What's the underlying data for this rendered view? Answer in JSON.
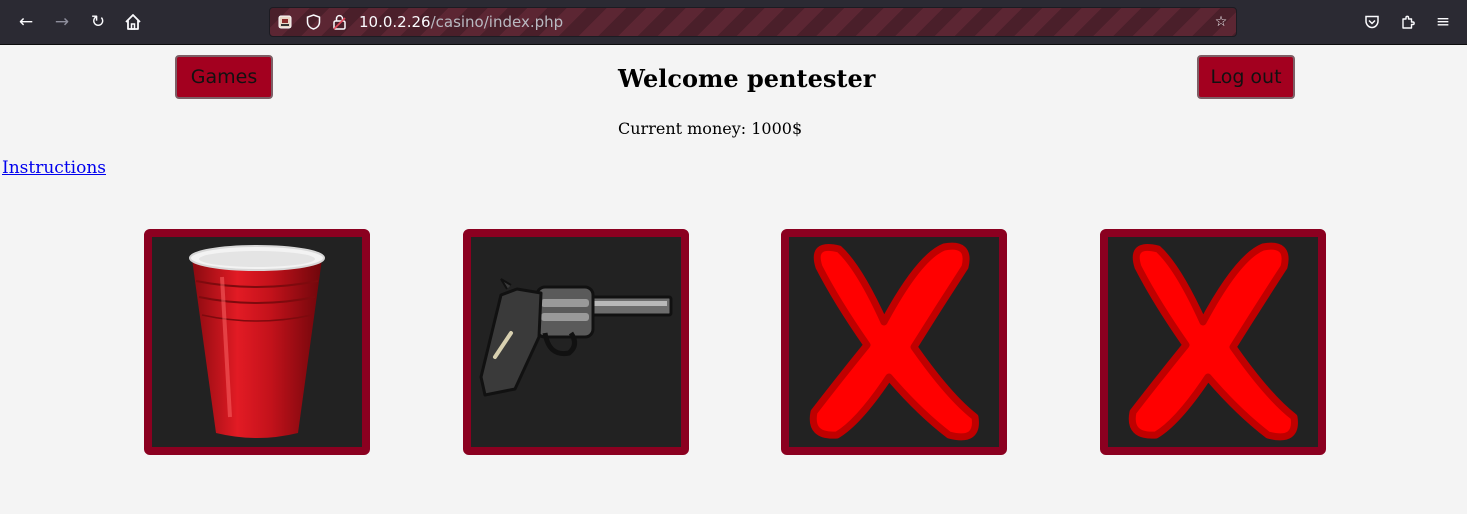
{
  "browser": {
    "url_host": "10.0.2.26",
    "url_path": "/casino/index.php",
    "icons": [
      "back-icon",
      "forward-icon",
      "reload-icon",
      "home-icon",
      "page-icon",
      "shield-icon",
      "lock-icon",
      "bookmark-star-icon",
      "pocket-icon",
      "extensions-icon",
      "menu-icon"
    ]
  },
  "header": {
    "games_label": "Games",
    "title": "Welcome pentester",
    "money_label": "Current money: 1000$",
    "logout_label": "Log out"
  },
  "instructions_label": "Instructions",
  "cards": [
    {
      "content": "red-cup"
    },
    {
      "content": "revolver"
    },
    {
      "content": "red-x"
    },
    {
      "content": "red-x"
    }
  ],
  "colors": {
    "button_bg": "#a3001f",
    "card_border": "#8b0020",
    "card_bg": "#222222",
    "page_bg": "#f4f4f4",
    "toolbar_bg": "#2b2a33"
  }
}
